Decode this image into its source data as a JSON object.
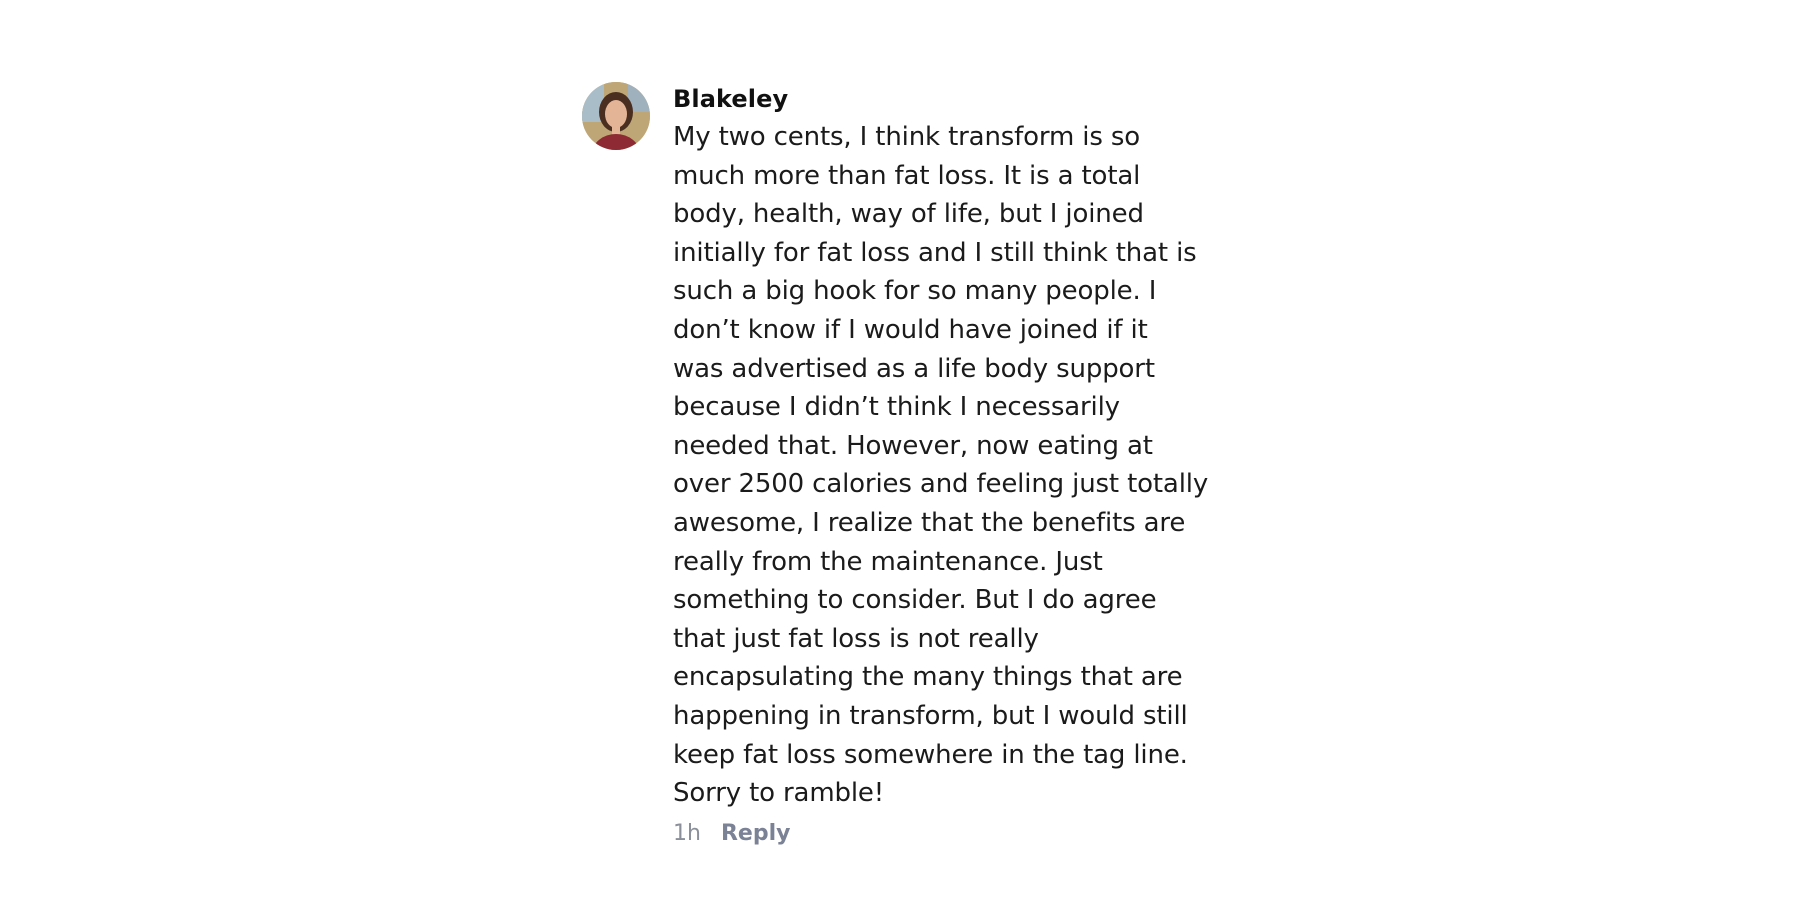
{
  "comment": {
    "avatar_icon": "user-avatar-photo",
    "author": "Blakeley",
    "lines": [
      "My two cents, I think transform is so",
      "much more than fat loss. It is a total",
      "body, health, way of life, but I joined",
      "initially for fat loss and I still think that is",
      "such a big hook for so many people. I",
      "don’t know if I would have joined if it",
      "was advertised as a life body support",
      "because I didn’t think I necessarily",
      "needed that. However, now eating at",
      "over 2500 calories and feeling just totally",
      "awesome, I realize that the benefits are",
      "really from the maintenance. Just",
      "something to consider. But I do agree",
      "that just fat loss is not really",
      "encapsulating the many things that are",
      "happening in transform, but I would still",
      "keep fat loss somewhere in the tag line.",
      "Sorry to ramble!"
    ],
    "timestamp": "1h",
    "reply_label": "Reply"
  }
}
